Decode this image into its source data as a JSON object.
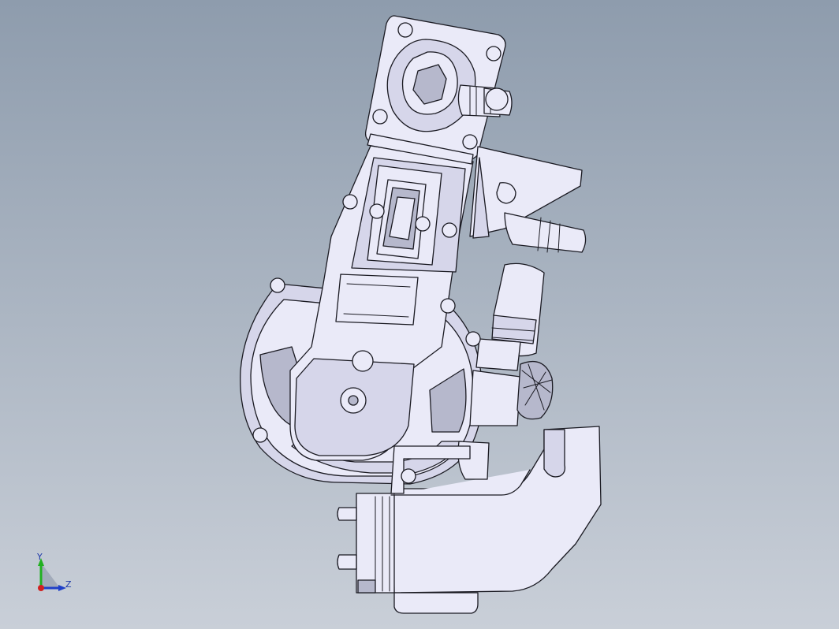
{
  "viewport": {
    "background_top": "#8e9cad",
    "background_bottom": "#c9cfd8"
  },
  "model": {
    "fill": "#eaeaf8",
    "fill_shade": "#d6d6ea",
    "fill_dark": "#b6b8cc",
    "edge": "#1a1a22"
  },
  "triad": {
    "y_label": "Y",
    "z_label": "Z",
    "y_color": "#21b021",
    "z_color": "#2040c8",
    "x_color": "#d02020",
    "label_color": "#1f3aa8",
    "icon": "coordinate-triad-icon"
  }
}
